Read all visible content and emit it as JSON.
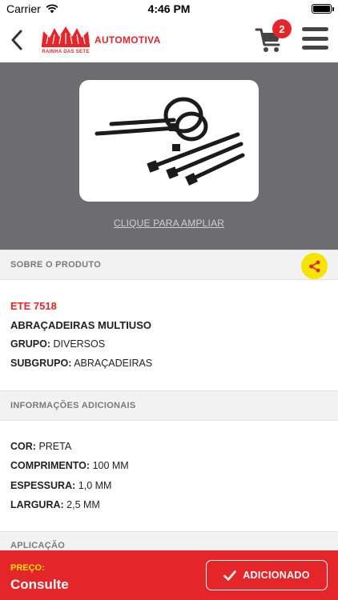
{
  "status_bar": {
    "carrier": "Carrier",
    "time": "4:46 PM"
  },
  "header": {
    "logo_subtitle": "RAINHA DAS SETE",
    "logo_text": "AUTOMOTIVA",
    "cart_count": "2",
    "colors": {
      "brand": "#e4262a",
      "accent": "#f5e400"
    }
  },
  "product_image": {
    "zoom_link": "CLIQUE PARA AMPLIAR"
  },
  "about": {
    "section_title": "SOBRE O PRODUTO",
    "code": "ETE 7518",
    "name": "ABRAÇADEIRAS MULTIUSO",
    "group_label": "GRUPO:",
    "group_value": "DIVERSOS",
    "subgroup_label": "SUBGRUPO:",
    "subgroup_value": "ABRAÇADEIRAS"
  },
  "additional": {
    "section_title": "INFORMAÇÕES ADICIONAIS",
    "rows": [
      {
        "label": "COR:",
        "value": "PRETA"
      },
      {
        "label": "COMPRIMENTO:",
        "value": "100 MM"
      },
      {
        "label": "ESPESSURA:",
        "value": "1,0 MM"
      },
      {
        "label": "LARGURA:",
        "value": "2,5 MM"
      }
    ]
  },
  "application": {
    "section_title": "APLICAÇÃO"
  },
  "bottom_bar": {
    "price_label": "PREÇO:",
    "price_value": "Consulte",
    "add_button_label": "ADICIONADO"
  }
}
